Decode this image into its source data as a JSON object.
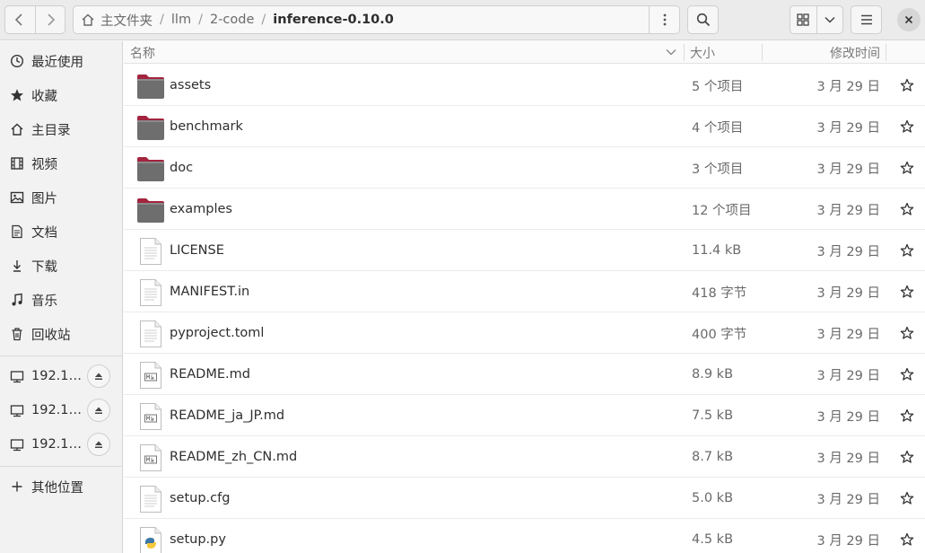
{
  "toolbar": {
    "back_icon": "chevron-left-icon",
    "forward_icon": "chevron-right-icon",
    "home_icon": "home-icon",
    "path": [
      "主文件夹",
      "llm",
      "2-code",
      "inference-0.10.0"
    ],
    "path_menu_icon": "vertical-dots-icon",
    "search_icon": "search-icon",
    "grid_icon": "grid-view-icon",
    "view_dropdown_icon": "chevron-down-icon",
    "menu_icon": "hamburger-menu-icon",
    "close_icon": "close-icon"
  },
  "sidebar": {
    "items": [
      {
        "label": "最近使用",
        "icon": "clock-icon"
      },
      {
        "label": "收藏",
        "icon": "star-icon"
      },
      {
        "label": "主目录",
        "icon": "home-icon"
      },
      {
        "label": "视频",
        "icon": "film-icon"
      },
      {
        "label": "图片",
        "icon": "image-icon"
      },
      {
        "label": "文档",
        "icon": "document-icon"
      },
      {
        "label": "下载",
        "icon": "download-icon"
      },
      {
        "label": "音乐",
        "icon": "music-icon"
      },
      {
        "label": "回收站",
        "icon": "trash-icon"
      }
    ],
    "network": [
      {
        "label": "192.1…",
        "icon": "network-drive-icon",
        "eject_icon": "eject-icon"
      },
      {
        "label": "192.1…",
        "icon": "network-drive-icon",
        "eject_icon": "eject-icon"
      },
      {
        "label": "192.1…",
        "icon": "network-drive-icon",
        "eject_icon": "eject-icon"
      }
    ],
    "other": {
      "label": "其他位置",
      "icon": "plus-icon"
    }
  },
  "columns": {
    "name": "名称",
    "size": "大小",
    "modified": "修改时间"
  },
  "files": [
    {
      "name": "assets",
      "size": "5 个项目",
      "date": "3 月 29 日",
      "type": "folder"
    },
    {
      "name": "benchmark",
      "size": "4 个项目",
      "date": "3 月 29 日",
      "type": "folder"
    },
    {
      "name": "doc",
      "size": "3 个项目",
      "date": "3 月 29 日",
      "type": "folder"
    },
    {
      "name": "examples",
      "size": "12 个项目",
      "date": "3 月 29 日",
      "type": "folder"
    },
    {
      "name": "LICENSE",
      "size": "11.4 kB",
      "date": "3 月 29 日",
      "type": "text"
    },
    {
      "name": "MANIFEST.in",
      "size": "418 字节",
      "date": "3 月 29 日",
      "type": "text"
    },
    {
      "name": "pyproject.toml",
      "size": "400 字节",
      "date": "3 月 29 日",
      "type": "text"
    },
    {
      "name": "README.md",
      "size": "8.9 kB",
      "date": "3 月 29 日",
      "type": "markdown"
    },
    {
      "name": "README_ja_JP.md",
      "size": "7.5 kB",
      "date": "3 月 29 日",
      "type": "markdown"
    },
    {
      "name": "README_zh_CN.md",
      "size": "8.7 kB",
      "date": "3 月 29 日",
      "type": "markdown"
    },
    {
      "name": "setup.cfg",
      "size": "5.0 kB",
      "date": "3 月 29 日",
      "type": "text"
    },
    {
      "name": "setup.py",
      "size": "4.5 kB",
      "date": "3 月 29 日",
      "type": "python"
    }
  ]
}
